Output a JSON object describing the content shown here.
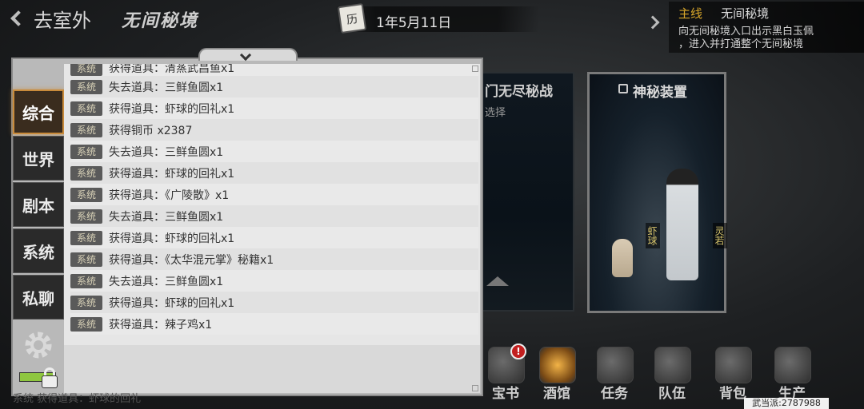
{
  "header": {
    "back_label": "去室外",
    "location": "无间秘境",
    "date": "1年5月11日"
  },
  "quest": {
    "type": "主线",
    "name": "无间秘境",
    "desc_line1": "向无间秘境入口出示黑白玉佩",
    "desc_line2": "，进入并打通整个无间秘境"
  },
  "cards": {
    "card1_title": "门无尽秘战",
    "card1_subtitle": "选择",
    "card2_title": "神秘装置",
    "shrimp_name": "虾球",
    "lingruo_name": "灵若"
  },
  "chat": {
    "tabs": [
      "综合",
      "世界",
      "剧本",
      "系统",
      "私聊"
    ],
    "active_tab": 0,
    "partial_top": "获得道具：清蒸武昌鱼x1",
    "messages": [
      {
        "channel": "系统",
        "text": "失去道具：三鲜鱼圆x1"
      },
      {
        "channel": "系统",
        "text": "获得道具：虾球的回礼x1"
      },
      {
        "channel": "系统",
        "text": "获得铜币 x2387"
      },
      {
        "channel": "系统",
        "text": "失去道具：三鲜鱼圆x1"
      },
      {
        "channel": "系统",
        "text": "获得道具：虾球的回礼x1"
      },
      {
        "channel": "系统",
        "text": "获得道具：《广陵散》x1"
      },
      {
        "channel": "系统",
        "text": "失去道具：三鲜鱼圆x1"
      },
      {
        "channel": "系统",
        "text": "获得道具：虾球的回礼x1"
      },
      {
        "channel": "系统",
        "text": "获得道具：《太华混元掌》秘籍x1"
      },
      {
        "channel": "系统",
        "text": "失去道具：三鲜鱼圆x1"
      },
      {
        "channel": "系统",
        "text": "获得道具：虾球的回礼x1"
      },
      {
        "channel": "系统",
        "text": "获得道具：辣子鸡x1"
      }
    ],
    "bottom_hint": "系统 获得道具：虾球的回礼"
  },
  "bottom_menu": [
    {
      "label": "宝书",
      "icon": "book-icon",
      "badge": "!"
    },
    {
      "label": "酒馆",
      "icon": "lantern-icon"
    },
    {
      "label": "任务",
      "icon": "scroll-icon"
    },
    {
      "label": "队伍",
      "icon": "swords-icon"
    },
    {
      "label": "背包",
      "icon": "bag-icon"
    },
    {
      "label": "生产",
      "icon": "anvil-icon"
    }
  ],
  "player": "武当派:2787988"
}
